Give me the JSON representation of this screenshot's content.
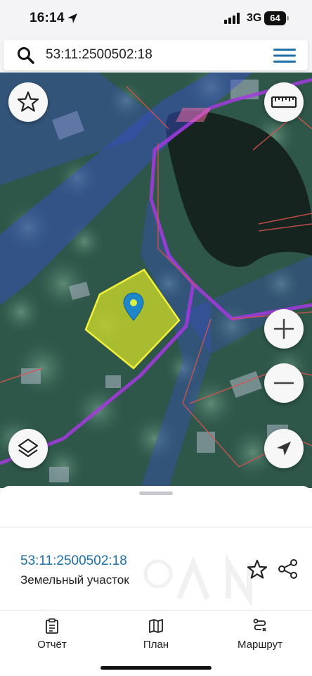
{
  "status_bar": {
    "time": "16:14",
    "network": "3G",
    "battery": "64"
  },
  "search": {
    "query": "53:11:2500502:18"
  },
  "map": {
    "colors": {
      "parcel_fill": "#c4d32a",
      "parcel_border": "#f2f03a",
      "marker": "#1f86c8",
      "road_zone": "#3a4fd0",
      "boundary_line": "#a43ae0",
      "cadastral_line": "#d9534f"
    }
  },
  "sheet": {
    "parcel_id": "53:11:2500502:18",
    "parcel_type": "Земельный участок"
  },
  "tabs": [
    {
      "label": "Отчёт",
      "icon": "clipboard-icon"
    },
    {
      "label": "План",
      "icon": "map-icon"
    },
    {
      "label": "Маршрут",
      "icon": "route-icon"
    }
  ]
}
